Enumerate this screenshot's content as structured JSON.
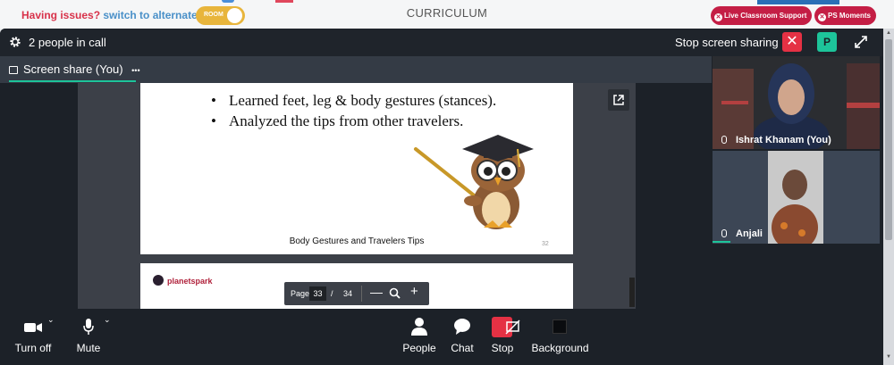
{
  "topbar": {
    "issues_question": "Having issues?",
    "issues_link": "switch to alternate room",
    "toggle_label": "ROOM",
    "center_title": "CURRICULUM",
    "live_support": "Live Classroom Support",
    "ps_moments": "PS Moments"
  },
  "call": {
    "people_count": "2 people in call",
    "stop_sharing": "Stop screen sharing",
    "profile_initial": "P",
    "share_tab": "Screen share (You)",
    "share_menu": "•••"
  },
  "slide": {
    "bullets": [
      "Learned feet, leg & body gestures (stances).",
      "Analyzed the tips from other travelers."
    ],
    "caption": "Body Gestures and Travelers Tips",
    "page_num": "32",
    "next_logo": "planetspark"
  },
  "pager": {
    "label": "Page",
    "current": "33",
    "separator": "/",
    "total": "34",
    "minus": "—",
    "plus": "+"
  },
  "participants": [
    {
      "name": "Ishrat Khanam (You)"
    },
    {
      "name": "Anjali"
    }
  ],
  "toolbar": {
    "camera": "Turn off",
    "mic": "Mute",
    "people": "People",
    "chat": "Chat",
    "stop": "Stop",
    "background": "Background"
  },
  "colors": {
    "accent_green": "#1dc49a",
    "danger_red": "#e53144",
    "brand_crimson": "#c41e45",
    "toggle_gold": "#e8b53c"
  }
}
